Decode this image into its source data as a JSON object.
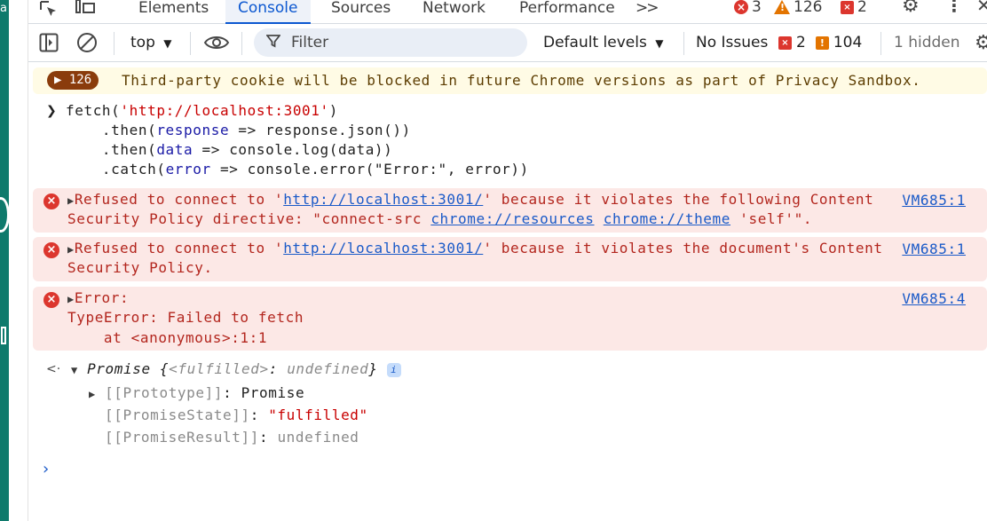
{
  "tabs": [
    {
      "label": "Elements"
    },
    {
      "label": "Console"
    },
    {
      "label": "Sources"
    },
    {
      "label": "Network"
    },
    {
      "label": "Performance"
    }
  ],
  "tabbar": {
    "more": ">>",
    "errors": "3",
    "warnings": "126",
    "issues": "2"
  },
  "toolbar": {
    "context": "top",
    "filter_placeholder": "Filter",
    "levels": "Default levels",
    "no_issues": "No Issues",
    "issue_errors": "2",
    "issue_warnings": "104",
    "hidden": "1 hidden"
  },
  "console": {
    "cookie_badge": "126",
    "cookie_text": "Third-party cookie will be blocked in future Chrome versions as part of Privacy Sandbox.",
    "input": {
      "l1_pre": "fetch(",
      "l1_str": "'http://localhost:3001'",
      "l1_post": ")",
      "l2_pre": "    .then(",
      "l2_var": "response",
      "l2_post": " => response.json())",
      "l3_pre": "    .then(",
      "l3_var": "data",
      "l3_post": " => console.log(data))",
      "l4_pre": "    .catch(",
      "l4_var": "error",
      "l4_post": " => console.error(\"Error:\", error))"
    },
    "err1": {
      "a": "Refused to connect to '",
      "link": "http://localhost:3001/",
      "b": "' because it violates the following Content",
      "c": "Security Policy directive: \"connect-src ",
      "link2": "chrome://resources",
      "link3": "chrome://theme",
      "d": " 'self'\".",
      "source": "VM685:1"
    },
    "err2": {
      "a": "Refused to connect to '",
      "link": "http://localhost:3001/",
      "b": "' because it violates the document's Content",
      "c": "Security Policy.",
      "source": "VM685:1"
    },
    "err3": {
      "a": "Error:",
      "b": "TypeError: Failed to fetch",
      "c": "    at <anonymous>:1:1",
      "source": "VM685:4"
    },
    "promise": {
      "head": "Promise {",
      "fulfilled_key": "<fulfilled>",
      "colon": ": ",
      "undef": "undefined",
      "close": "}",
      "proto_key": "[[Prototype]]",
      "proto_val": "Promise",
      "state_key": "[[PromiseState]]",
      "state_val": "\"fulfilled\"",
      "result_key": "[[PromiseResult]]",
      "result_val": "undefined"
    }
  }
}
